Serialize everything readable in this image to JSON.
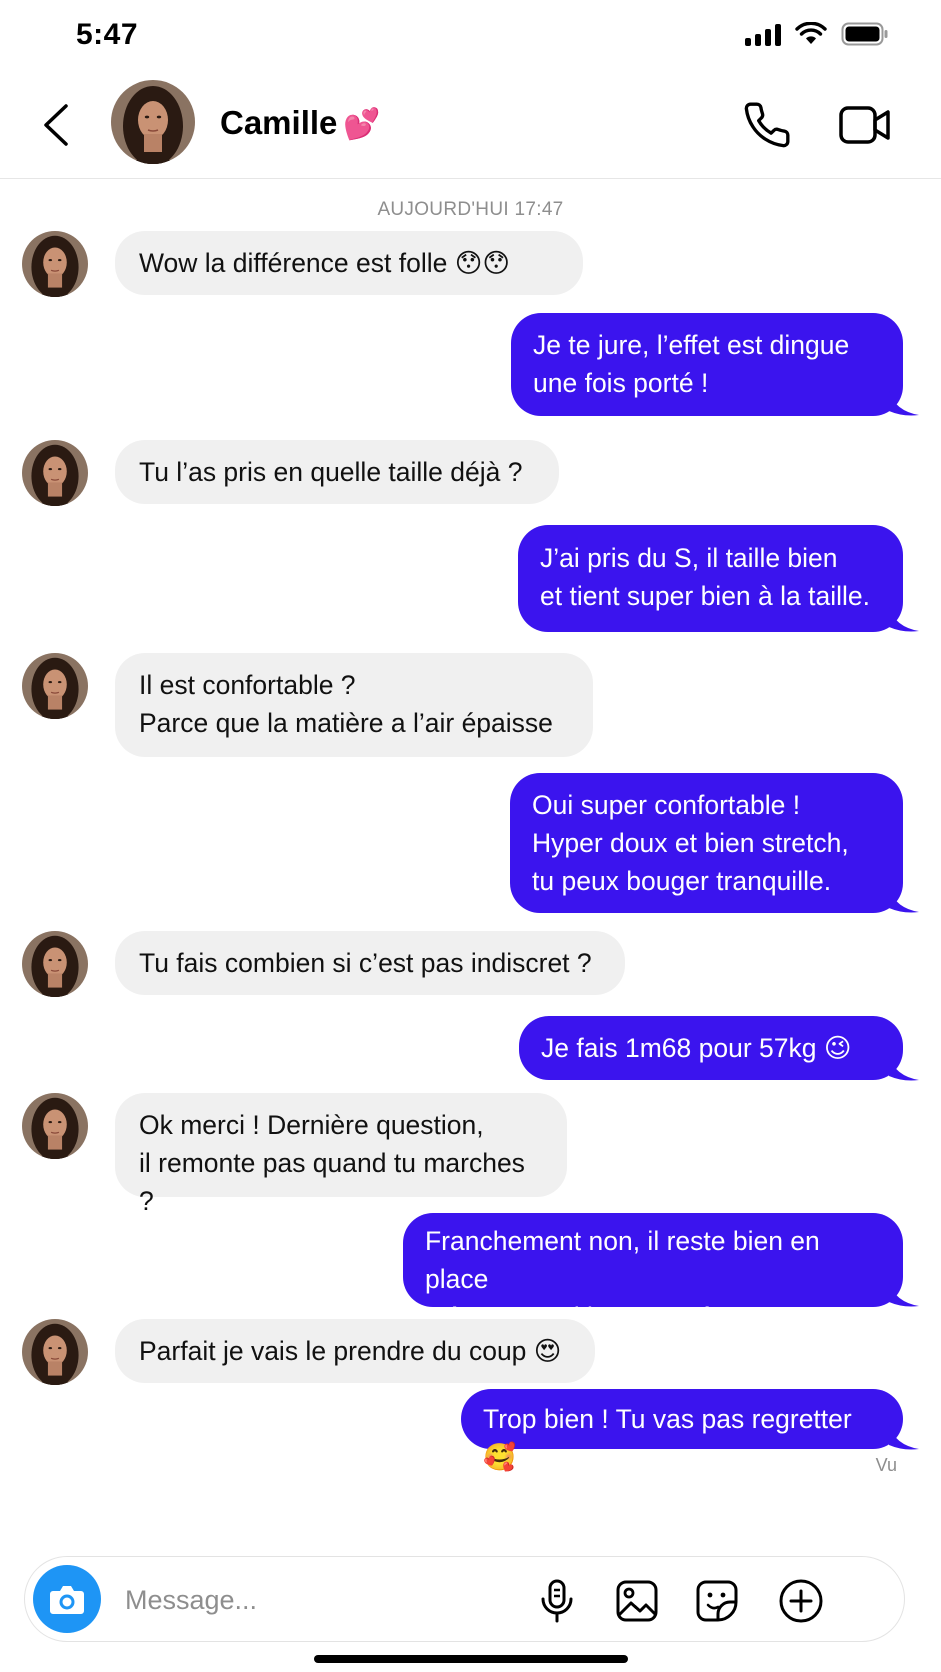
{
  "status_bar": {
    "time": "5:47"
  },
  "header": {
    "contact_name": "Camille",
    "name_emoji": "💕"
  },
  "chat": {
    "date_separator": "AUJOURD'HUI 17:47",
    "messages": [
      {
        "from": "them",
        "text": "Wow la différence est folle 😯😯"
      },
      {
        "from": "me",
        "text": "Je te jure, l’effet est dingue\nune fois porté !"
      },
      {
        "from": "them",
        "text": "Tu l’as pris en quelle taille déjà ?"
      },
      {
        "from": "me",
        "text": "J’ai pris du S, il taille bien\net tient super bien à la taille."
      },
      {
        "from": "them",
        "text": "Il est confortable ?\nParce que la matière a l’air épaisse"
      },
      {
        "from": "me",
        "text": "Oui super confortable !\nHyper doux et bien stretch,\ntu peux bouger tranquille."
      },
      {
        "from": "them",
        "text": "Tu fais combien si c’est pas indiscret ?"
      },
      {
        "from": "me",
        "text": "Je fais 1m68 pour 57kg 😉"
      },
      {
        "from": "them",
        "text": "Ok merci ! Dernière question,\nil remonte pas quand tu marches ?"
      },
      {
        "from": "me",
        "text": "Franchement non, il reste bien en place\nmême quand je m’entraîne."
      },
      {
        "from": "them",
        "text": "Parfait je vais le prendre du coup 😍"
      },
      {
        "from": "me",
        "text": "Trop bien ! Tu vas pas regretter 🥰"
      }
    ],
    "seen_label": "Vu"
  },
  "composer": {
    "placeholder": "Message..."
  },
  "icons": {
    "back": "chevron-left-icon",
    "call": "phone-icon",
    "video": "video-camera-icon",
    "camera": "camera-icon",
    "mic": "microphone-icon",
    "gallery": "image-icon",
    "sticker": "sticker-icon",
    "add": "plus-circle-icon"
  },
  "colors": {
    "outgoing_bubble": "#3b14ee",
    "incoming_bubble": "#f0f0f0",
    "camera_button": "#1e95f5"
  }
}
